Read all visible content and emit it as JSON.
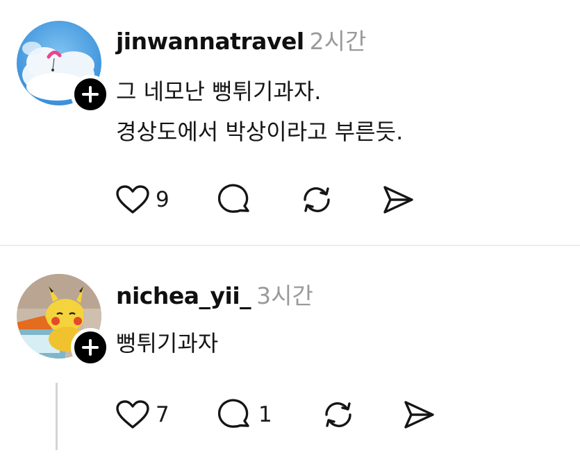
{
  "posts": [
    {
      "username": "jinwannatravel",
      "time": "2시간",
      "lines": [
        "그 네모난 뻥튀기과자.",
        "경상도에서 박상이라고 부른듯."
      ],
      "likes": "9",
      "replies": "",
      "avatar_icon": "paraglider-sky-photo",
      "follow_icon": "plus-icon"
    },
    {
      "username": "nichea_yii_",
      "time": "3시간",
      "lines": [
        "뻥튀기과자"
      ],
      "likes": "7",
      "replies": "1",
      "avatar_icon": "pikachu-plush-photo",
      "follow_icon": "plus-icon"
    }
  ],
  "icons": {
    "like": "heart-icon",
    "reply": "comment-icon",
    "repost": "repost-icon",
    "share": "send-icon"
  },
  "colors": {
    "text": "#101010",
    "muted": "#9a9a9a",
    "divider": "#ececec",
    "thread_line": "#d4d4d4"
  }
}
